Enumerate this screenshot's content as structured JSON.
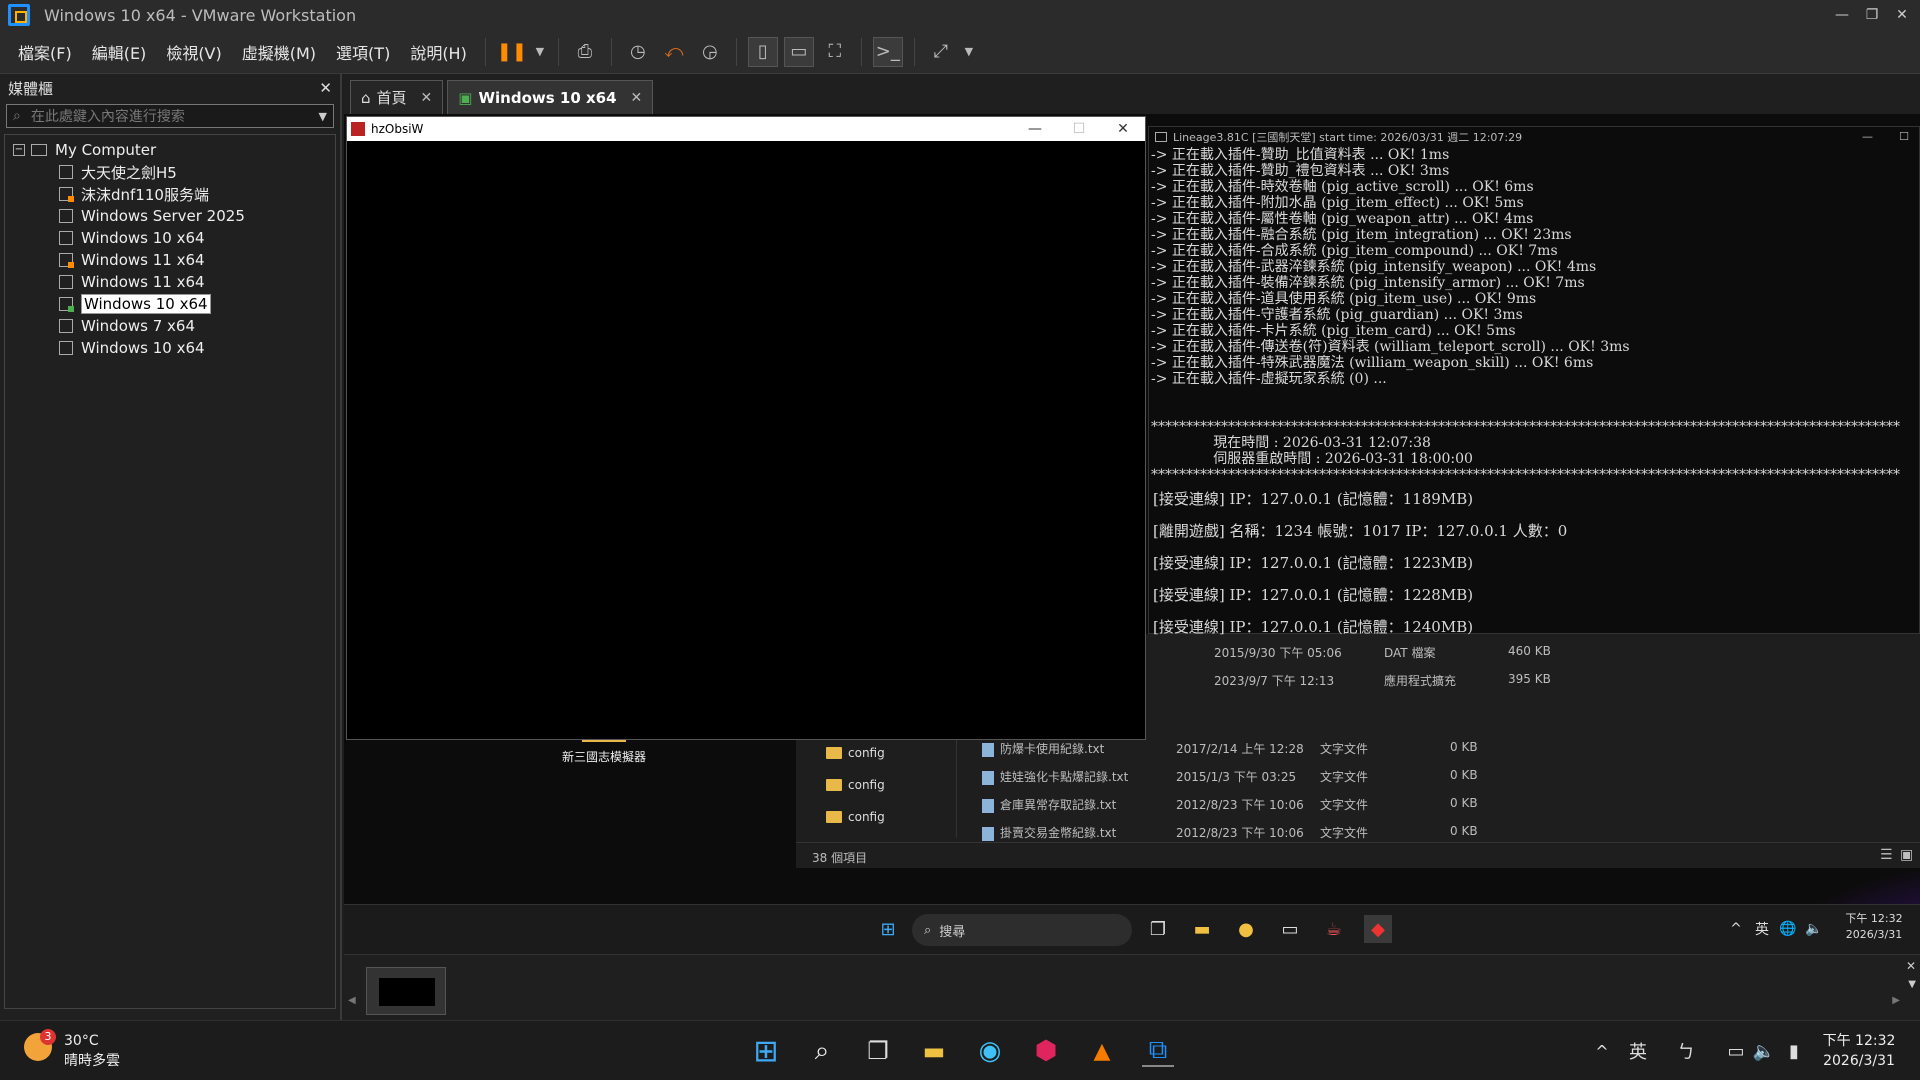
{
  "window": {
    "title": "Windows 10 x64 - VMware Workstation"
  },
  "menu": [
    "檔案(F)",
    "編輯(E)",
    "檢視(V)",
    "虛擬機(M)",
    "選項(T)",
    "說明(H)"
  ],
  "library": {
    "title": "媒體櫃",
    "search_placeholder": "在此處鍵入內容進行搜索",
    "root": "My Computer",
    "items": [
      {
        "label": "大天使之劍H5",
        "state": "off"
      },
      {
        "label": "沫沫dnf110服务端",
        "state": "pause"
      },
      {
        "label": "Windows Server 2025",
        "state": "off"
      },
      {
        "label": "Windows 10 x64",
        "state": "off"
      },
      {
        "label": "Windows 11 x64",
        "state": "pause"
      },
      {
        "label": "Windows 11 x64",
        "state": "off"
      },
      {
        "label": "Windows 10 x64",
        "state": "run"
      },
      {
        "label": "Windows 7 x64",
        "state": "off"
      },
      {
        "label": "Windows 10 x64",
        "state": "off"
      }
    ]
  },
  "tabs": [
    {
      "label": "首頁"
    },
    {
      "label": "Windows 10 x64"
    }
  ],
  "hzwin": {
    "title": "hzObsiW"
  },
  "console": {
    "title": "Lineage3.81C [三國制天堂] start time: 2026/03/31 週二 12:07:29",
    "log": [
      "-> 正在載入插件-贊助_比值資料表 ... OK! 1ms",
      "-> 正在載入插件-贊助_禮包資料表 ... OK! 3ms",
      "-> 正在載入插件-時效卷軸 (pig_active_scroll) ... OK! 6ms",
      "-> 正在載入插件-附加水晶 (pig_item_effect) ... OK! 5ms",
      "-> 正在載入插件-屬性卷軸 (pig_weapon_attr) ... OK! 4ms",
      "-> 正在載入插件-融合系統 (pig_item_integration) ... OK! 23ms",
      "-> 正在載入插件-合成系統 (pig_item_compound) ... OK! 7ms",
      "-> 正在載入插件-武器淬鍊系統 (pig_intensify_weapon) ... OK! 4ms",
      "-> 正在載入插件-裝備淬鍊系統 (pig_intensify_armor) ... OK! 7ms",
      "-> 正在載入插件-道具使用系統 (pig_item_use) ... OK! 9ms",
      "-> 正在載入插件-守護者系統 (pig_guardian) ... OK! 3ms",
      "-> 正在載入插件-卡片系統 (pig_item_card) ... OK! 5ms",
      "-> 正在載入插件-傳送卷(符)資料表 (william_teleport_scroll) ... OK! 3ms",
      "-> 正在載入插件-特殊武器魔法 (william_weapon_skill) ... OK! 6ms",
      "-> 正在載入插件-虛擬玩家系統 (0) ..."
    ],
    "stars": "***********************************************************************************************************",
    "now_time": "              現在時間 : 2026-03-31 12:07:38",
    "restart_time": "              伺服器重啟時間 : 2026-03-31 18:00:00",
    "events": [
      "[接受連線] IP：127.0.0.1 (記憶體：1189MB)",
      "[離開遊戲] 名稱：1234 帳號：1017 IP：127.0.0.1 人數：0",
      "[接受連線] IP：127.0.0.1 (記憶體：1223MB)",
      "[接受連線] IP：127.0.0.1 (記憶體：1228MB)",
      "[接受連線] IP：127.0.0.1 (記憶體：1240MB)"
    ]
  },
  "explorer": {
    "top_rows": [
      {
        "date": "2015/9/30 下午 05:06",
        "type": "DAT 檔案",
        "size": "460 KB"
      },
      {
        "date": "2023/9/7 下午 12:13",
        "type": "應用程式擴充",
        "size": "395 KB"
      }
    ],
    "folders": [
      "config",
      "config",
      "config"
    ],
    "files": [
      {
        "name": "防爆卡使用紀錄.txt",
        "date": "2017/2/14 上午 12:28",
        "type": "文字文件",
        "size": "0 KB"
      },
      {
        "name": "娃娃強化卡點爆記錄.txt",
        "date": "2015/1/3 下午 03:25",
        "type": "文字文件",
        "size": "0 KB"
      },
      {
        "name": "倉庫異常存取記錄.txt",
        "date": "2012/8/23 下午 10:06",
        "type": "文字文件",
        "size": "0 KB"
      },
      {
        "name": "掛賣交易金幣紀錄.txt",
        "date": "2012/8/23 下午 10:06",
        "type": "文字文件",
        "size": "0 KB"
      }
    ],
    "status": "38 個項目"
  },
  "desktop_icon": "新三國志模擬器",
  "vm_taskbar": {
    "search": "搜尋",
    "ime": "英",
    "time": "下午 12:32",
    "date": "2026/3/31"
  },
  "host_taskbar": {
    "weather_badge": "3",
    "temp": "30°C",
    "cond": "晴時多雲",
    "ime": "英",
    "ime2": "ㄅ",
    "time": "下午 12:32",
    "date": "2026/3/31"
  },
  "colors": {
    "accent": "#1e90ff",
    "selected": "#ffffff"
  }
}
